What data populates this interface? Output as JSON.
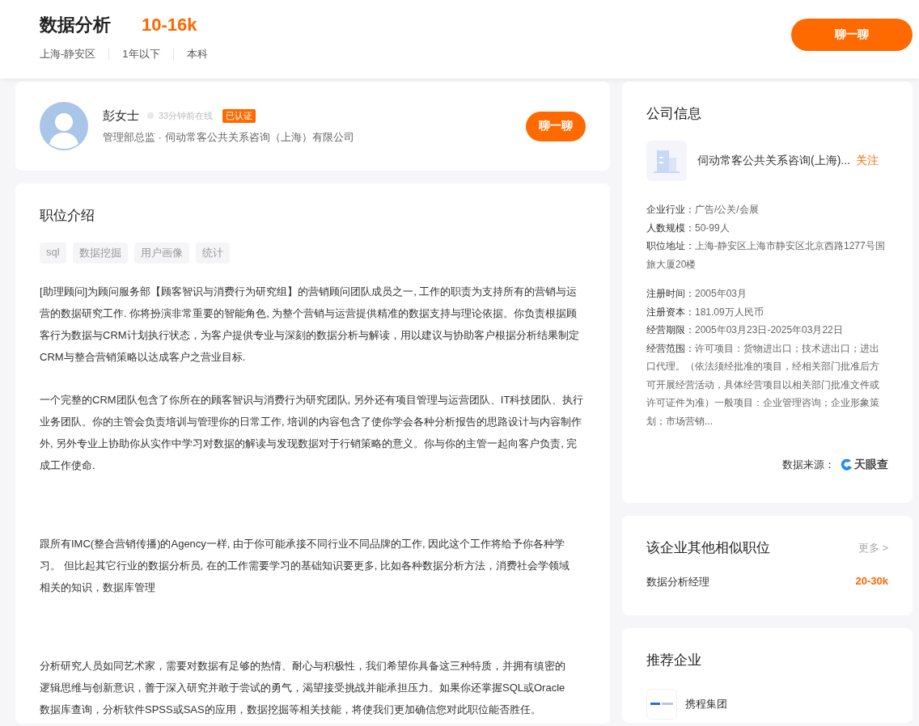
{
  "job": {
    "title": "数据分析",
    "salary": "10-16k",
    "meta": [
      "上海-静安区",
      "1年以下",
      "本科"
    ],
    "chat_button": "聊一聊"
  },
  "recruiter": {
    "name": "彭女士",
    "online": "33分钟前在线",
    "badge": "已认证",
    "subtitle": "管理部总监 · 伺动常客公共关系咨询（上海）有限公司",
    "chat_button": "聊一聊"
  },
  "description": {
    "title": "职位介绍",
    "tags": [
      "sql",
      "数据挖掘",
      "用户画像",
      "统计"
    ],
    "paragraphs": [
      "[助理顾问]为顾问服务部【顾客智识与消费行为研究组】的营销顾问团队成员之一, 工作的职责为支持所有的营销与运营的数据研究工作. 你将扮演非常重要的智能角色, 为整个营销与运营提供精准的数据支持与理论依据。你负责根据顾客行为数据与CRM计划执行状态，为客户提供专业与深刻的数据分析与解读，用以建议与协助客户根据分析结果制定CRM与整合营销策略以达成客户之营业目标.",
      "一个完整的CRM团队包含了你所在的顾客智识与消费行为研究团队, 另外还有项目管理与运营团队、IT科技团队、执行业务团队。你的主管会负责培训与管理你的日常工作, 培训的内容包含了使你学会各种分析报告的思路设计与内容制作外, 另外专业上协助你从实作中学习对数据的解读与发现数据对于行销策略的意义。你与你的主管一起向客户负责, 完成工作使命.",
      "跟所有IMC(整合营销传播)的Agency一样, 由于你可能承接不同行业不同品牌的工作, 因此这个工作将给予你各种学习。 但比起其它行业的数据分析员, 在的工作需要学习的基础知识要更多, 比如各种数据分析方法，消费社会学领域相关的知识，数据库管理",
      "分析研究人员如同艺术家，需要对数据有足够的热情、耐心与积极性，我们希望你具备这三种特质，并拥有缜密的逻辑思维与创新意识，善于深入研究并敢于尝试的勇气，渴望接受挑战并能承担压力。如果你还掌握SQL或Oracle数据库查询，分析软件SPSS或SAS的应用，数据挖掘等相关技能，将使我们更加确信您对此职位能否胜任。"
    ]
  },
  "company_info": {
    "title": "公司信息",
    "name": "伺动常客公共关系咨询(上海)...",
    "follow": "关注",
    "basic": [
      {
        "label": "企业行业：",
        "value": "广告/公关/会展"
      },
      {
        "label": "人数规模：",
        "value": "50-99人"
      },
      {
        "label": "职位地址：",
        "value": "上海-静安区上海市静安区北京西路1277号国旅大厦20楼"
      }
    ],
    "registration": [
      {
        "label": "注册时间：",
        "value": "2005年03月"
      },
      {
        "label": "注册资本：",
        "value": "181.09万人民币"
      },
      {
        "label": "经营期限：",
        "value": "2005年03月23日-2025年03月22日"
      },
      {
        "label": "经营范围：",
        "value": "许可项目：货物进出口；技术进出口；进出口代理。（依法须经批准的项目，经相关部门批准后方可开展经营活动，具体经营项目以相关部门批准文件或许可证件为准）一般项目：企业管理咨询；企业形象策划；市场营销..."
      }
    ],
    "source_label": "数据来源：",
    "source_brand": "天眼查"
  },
  "similar_jobs": {
    "title": "该企业其他相似职位",
    "more": "更多 >",
    "items": [
      {
        "name": "数据分析经理",
        "salary": "20-30k"
      }
    ]
  },
  "recommended": {
    "title": "推荐企业",
    "items": [
      {
        "name": "携程集团"
      }
    ]
  }
}
